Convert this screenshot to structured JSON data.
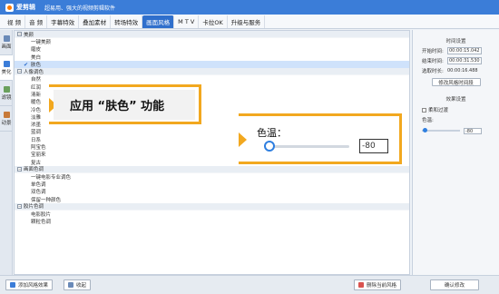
{
  "app": {
    "name": "爱剪辑",
    "slogan": "超易用、强大的视频剪辑软件"
  },
  "menu": [
    {
      "label": "视  频"
    },
    {
      "label": "音  频"
    },
    {
      "label": "字幕特效"
    },
    {
      "label": "叠加素材"
    },
    {
      "label": "转场特效"
    },
    {
      "label": "画面风格",
      "active": true
    },
    {
      "label": "M T V"
    },
    {
      "label": "卡拉OK"
    },
    {
      "label": "升级与服务"
    }
  ],
  "left_tabs": [
    {
      "label": "画面",
      "icon": "picture-icon",
      "color": "#6a8ab8"
    },
    {
      "label": "美化",
      "icon": "beautify-icon",
      "color": "#3b7dd8",
      "active": true
    },
    {
      "label": "滤镜",
      "icon": "filter-icon",
      "color": "#6aa05c"
    },
    {
      "label": "动景",
      "icon": "motion-icon",
      "color": "#c77a3a"
    }
  ],
  "categories": [
    {
      "label": "美颜",
      "items": [
        {
          "label": "一键美颜"
        },
        {
          "label": "磨皮"
        },
        {
          "label": "美白"
        },
        {
          "label": "肤色",
          "selected": true
        }
      ]
    },
    {
      "label": "人像调色",
      "items": [
        {
          "label": "自然"
        },
        {
          "label": "红润"
        },
        {
          "label": "清新"
        },
        {
          "label": "暖色"
        },
        {
          "label": "冷色"
        },
        {
          "label": "淡雅"
        },
        {
          "label": "浓墨"
        },
        {
          "label": "蓝调"
        },
        {
          "label": "日系"
        },
        {
          "label": "阿宝色"
        },
        {
          "label": "宝丽来"
        },
        {
          "label": "复古"
        }
      ]
    },
    {
      "label": "画面色调",
      "items": [
        {
          "label": "一键电影专业调色"
        },
        {
          "label": "单色调"
        },
        {
          "label": "双色调"
        },
        {
          "label": "保留一种颜色"
        }
      ]
    },
    {
      "label": "胶片色调",
      "items": [
        {
          "label": "电影胶片"
        },
        {
          "label": "颗粒色调"
        }
      ]
    }
  ],
  "callout": {
    "text": "应用 “肤色” 功能"
  },
  "popup": {
    "label": "色温：",
    "value": "-80",
    "slider_fraction": 0.02
  },
  "right_panel": {
    "time_section": "时间设置",
    "start_label": "开始时间:",
    "start_value": "00:00:15.042",
    "end_label": "结束时间:",
    "end_value": "00:00:31.530",
    "duration_label": "选取时长:",
    "duration_value": "00:00:16.488",
    "modify_time_btn": "修改风格时间段",
    "effect_section": "效果设置",
    "soft_transition": "柔和过渡",
    "color_temp_label": "色温:",
    "color_temp_value": "-80",
    "confirm_btn": "确认修改"
  },
  "bottom": {
    "add_btn": "添加风格效果",
    "collapse_btn": "收起",
    "delete_btn": "删除当前风格"
  },
  "colors": {
    "accent": "#2f6fcc",
    "highlight": "#f2a81f",
    "titlebar": "#3b7dd8"
  }
}
